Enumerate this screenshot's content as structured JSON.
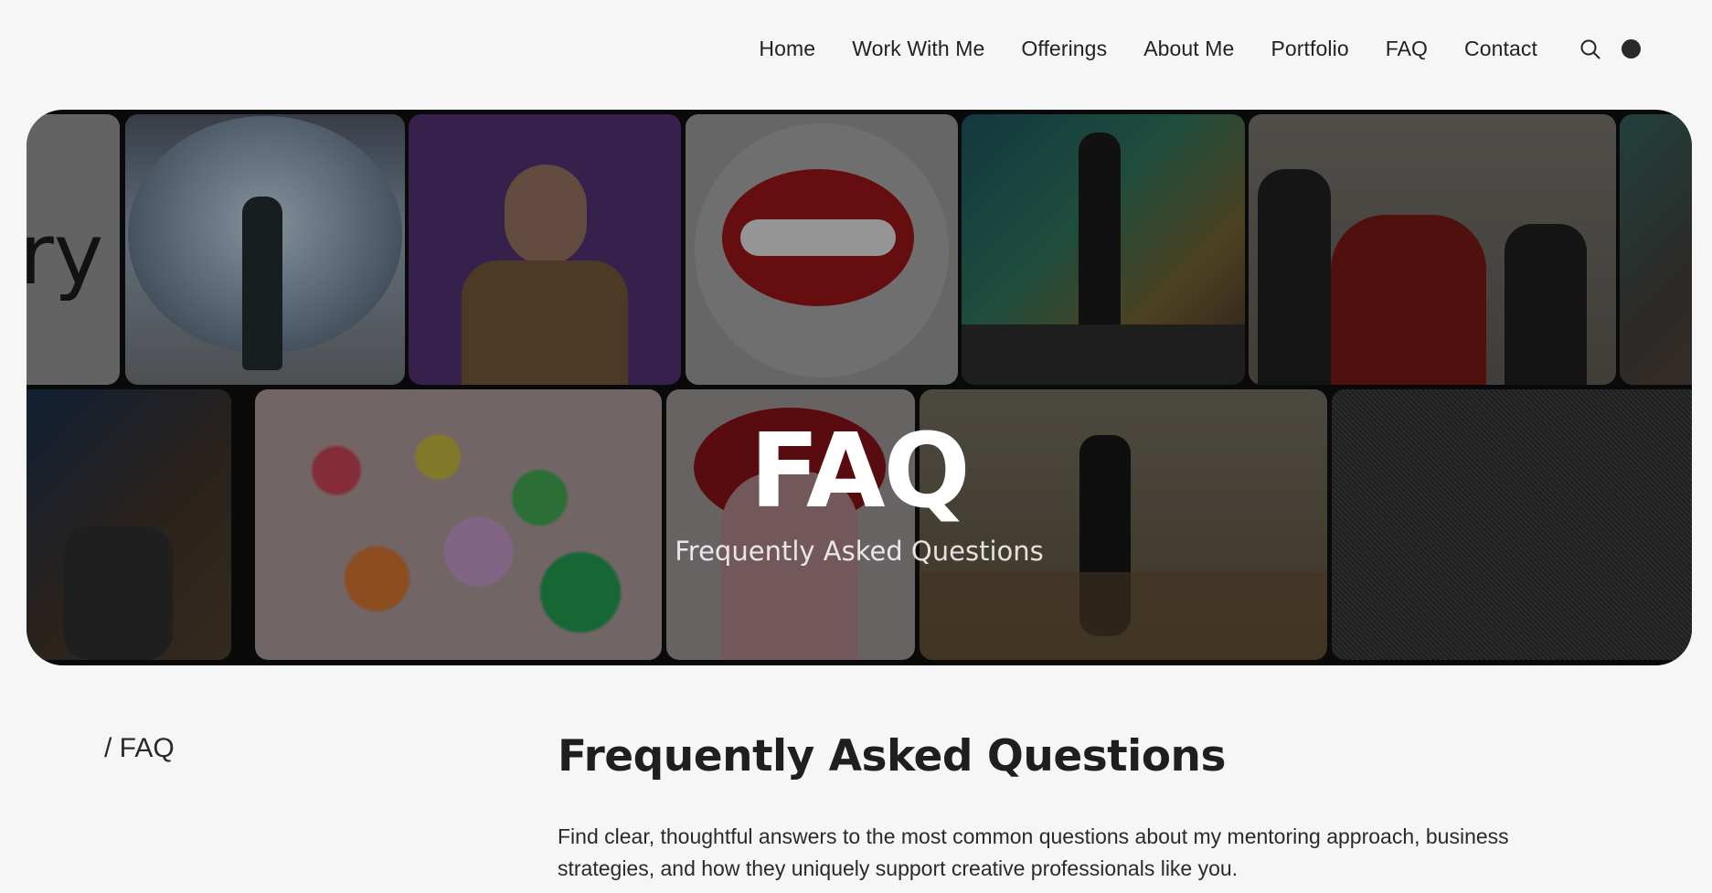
{
  "nav": {
    "items": [
      {
        "label": "Home"
      },
      {
        "label": "Work With Me"
      },
      {
        "label": "Offerings"
      },
      {
        "label": "About Me"
      },
      {
        "label": "Portfolio"
      },
      {
        "label": "FAQ"
      },
      {
        "label": "Contact"
      }
    ],
    "search_icon": "search-icon",
    "theme_toggle_icon": "dark-mode-dot-icon"
  },
  "hero": {
    "title": "FAQ",
    "subtitle": "Frequently Asked Questions",
    "tile_fragment_text": "ry"
  },
  "breadcrumb": "/ FAQ",
  "section": {
    "heading": "Frequently Asked Questions",
    "intro": "Find clear, thoughtful answers to the most common questions about my mentoring approach, business strategies, and how they uniquely support creative professionals like you."
  },
  "colors": {
    "page_bg": "#f6f6f6",
    "text": "#1f1f1f",
    "hero_bg": "#0e0e0e"
  }
}
